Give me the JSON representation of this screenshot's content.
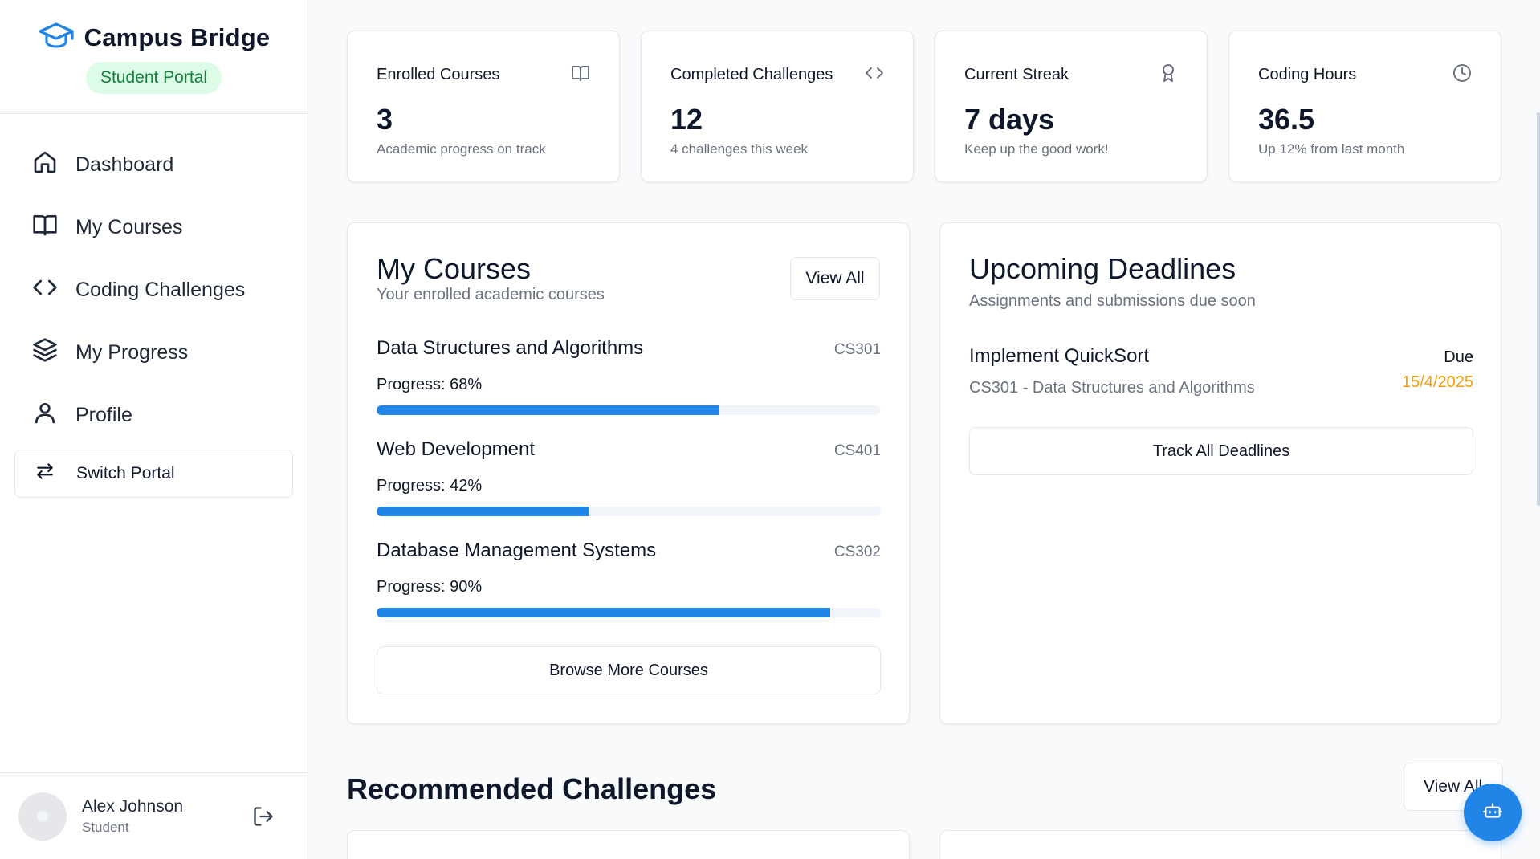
{
  "brand": {
    "title": "Campus Bridge",
    "badge": "Student Portal"
  },
  "sidebar": {
    "items": [
      {
        "label": "Dashboard",
        "icon": "home-icon"
      },
      {
        "label": "My Courses",
        "icon": "book-icon"
      },
      {
        "label": "Coding Challenges",
        "icon": "code-icon"
      },
      {
        "label": "My Progress",
        "icon": "layers-icon"
      },
      {
        "label": "Profile",
        "icon": "user-icon"
      }
    ],
    "switch_label": "Switch Portal"
  },
  "user": {
    "name": "Alex Johnson",
    "role": "Student"
  },
  "stats": [
    {
      "label": "Enrolled Courses",
      "value": "3",
      "sub": "Academic progress on track",
      "icon": "book-icon"
    },
    {
      "label": "Completed Challenges",
      "value": "12",
      "sub": "4 challenges this week",
      "icon": "code-icon"
    },
    {
      "label": "Current Streak",
      "value": "7 days",
      "sub": "Keep up the good work!",
      "icon": "award-icon"
    },
    {
      "label": "Coding Hours",
      "value": "36.5",
      "sub": "Up 12% from last month",
      "icon": "clock-icon"
    }
  ],
  "courses_panel": {
    "title": "My Courses",
    "subtitle": "Your enrolled academic courses",
    "view_all": "View All",
    "courses": [
      {
        "name": "Data Structures and Algorithms",
        "code": "CS301",
        "progress_label": "Progress: 68%",
        "progress": 0.68
      },
      {
        "name": "Web Development",
        "code": "CS401",
        "progress_label": "Progress: 42%",
        "progress": 0.42
      },
      {
        "name": "Database Management Systems",
        "code": "CS302",
        "progress_label": "Progress: 90%",
        "progress": 0.9
      }
    ],
    "browse": "Browse More Courses"
  },
  "deadlines_panel": {
    "title": "Upcoming Deadlines",
    "subtitle": "Assignments and submissions due soon",
    "items": [
      {
        "title": "Implement QuickSort",
        "course": "CS301 - Data Structures and Algorithms",
        "due_label": "Due",
        "due_date": "15/4/2025"
      }
    ],
    "track_all": "Track All Deadlines"
  },
  "recommended": {
    "title": "Recommended Challenges",
    "view_all": "View All"
  },
  "colors": {
    "accent": "#2185e8",
    "badge_bg": "#dcfce7",
    "badge_text": "#15803d",
    "due": "#f59e0b"
  }
}
